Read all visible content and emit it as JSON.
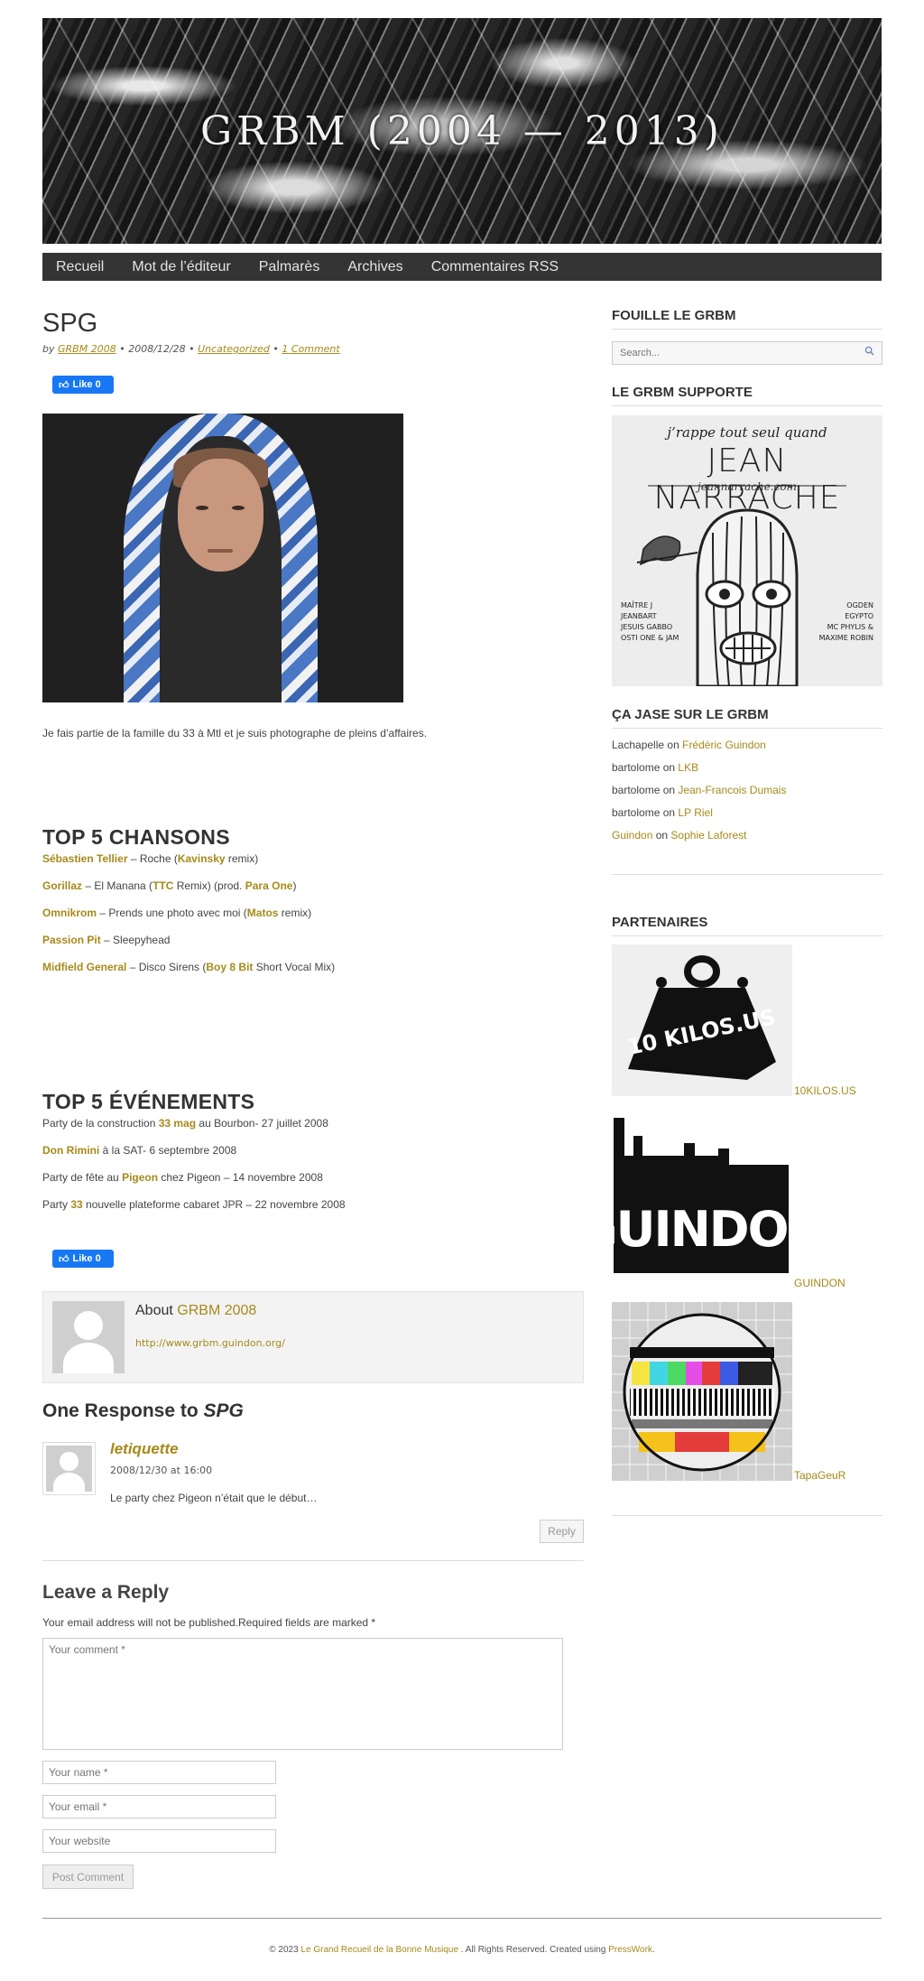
{
  "site": {
    "title": "GRBM (2004 — 2013)"
  },
  "nav": {
    "items": [
      "Recueil",
      "Mot de l’éditeur",
      "Palmarès",
      "Archives",
      "Commentaires RSS"
    ]
  },
  "post": {
    "title": "SPG",
    "meta": {
      "by": "by",
      "author": "GRBM 2008",
      "sep1": "•",
      "date": "2008/12/28",
      "sep2": "•",
      "category": "Uncategorized",
      "sep3": "•",
      "comments": "1 Comment"
    },
    "like_label": "Like 0",
    "intro": "Je fais partie de la famille du 33 à Mtl et je suis photographe de pleins d’affaires.",
    "chansons_title": "TOP 5 CHANSONS",
    "chansons": [
      {
        "artist": "Sébastien Tellier",
        "rest": [
          " – Roche (",
          "Kavinsky",
          " remix)"
        ]
      },
      {
        "artist": "Gorillaz",
        "rest": [
          " – El Manana (",
          "TTC",
          " Remix) (prod. ",
          "Para One",
          ")"
        ]
      },
      {
        "artist": "Omnikrom",
        "rest": [
          " – Prends une photo avec moi (",
          "Matos",
          " remix)"
        ]
      },
      {
        "artist": "Passion Pit",
        "rest": [
          " – Sleepyhead"
        ]
      },
      {
        "artist": "Midfield General",
        "rest": [
          " – Disco Sirens (",
          "Boy 8 Bit",
          " Short Vocal Mix)"
        ]
      }
    ],
    "evenements_title": "TOP 5 ÉVÉNEMENTS",
    "evenements": [
      [
        "Party de la construction ",
        "33 mag",
        " au Bourbon- 27 juillet 2008"
      ],
      [
        "",
        "Don Rimini",
        " à la SAT- 6 septembre 2008"
      ],
      [
        "Party de fête au ",
        "Pigeon",
        " chez Pigeon – 14 novembre 2008"
      ],
      [
        "Party ",
        "33",
        " nouvelle plateforme cabaret JPR – 22 novembre 2008"
      ]
    ]
  },
  "author_box": {
    "about": "About",
    "name": "GRBM 2008",
    "url": "http://www.grbm.guindon.org/"
  },
  "responses": {
    "title_prefix": "One Response to",
    "title_post": "SPG",
    "comment": {
      "author": "letiquette",
      "date": "2008/12/30 at 16:00",
      "text": "Le party chez Pigeon n’était que le début…",
      "reply_label": "Reply"
    }
  },
  "reply_form": {
    "title": "Leave a Reply",
    "note": "Your email address will not be published.Required fields are marked *",
    "comment_placeholder": "Your comment *",
    "name_placeholder": "Your name *",
    "email_placeholder": "Your email *",
    "website_placeholder": "Your website",
    "submit_label": "Post Comment"
  },
  "sidebar": {
    "search_title": "FOUILLE LE GRBM",
    "search_placeholder": "Search...",
    "supporte_title": "LE GRBM SUPPORTE",
    "narrache": {
      "script": "j’rappe tout seul quand",
      "name": "JEAN NARRACHE",
      "url": "jeannarrache.com",
      "left_names": [
        "MAÎTRE J",
        "JEANBART",
        "JESUIS GABBO",
        "OSTI ONE & JAM"
      ],
      "right_names": [
        "OGDEN",
        "EGYPTO",
        "MC PHYLIS &",
        "MAXIME ROBIN"
      ]
    },
    "jase_title": "ÇA JASE SUR LE GRBM",
    "recent_comments": [
      {
        "who": "Lachapelle",
        "on": "on",
        "post": "Frédéric Guindon"
      },
      {
        "who": "bartolome",
        "on": "on",
        "post": "LKB"
      },
      {
        "who": "bartolome",
        "on": "on",
        "post": "Jean-Francois Dumais"
      },
      {
        "who": "bartolome",
        "on": "on",
        "post": "LP Riel"
      },
      {
        "who": "Guindon",
        "on": "on",
        "post": "Sophie Laforest"
      }
    ],
    "partenaires_title": "PARTENAIRES",
    "partners": [
      "10KILOS.US",
      "GUINDON",
      "TapaGeuR"
    ],
    "kilos_logo": "10 KILOS.US",
    "guindon_logo": "GUINDON"
  },
  "footer": {
    "prefix": "© 2023 ",
    "site": "Le Grand Recueil de la Bonne Musique",
    "middle": " . All Rights Reserved. Created using ",
    "theme": "PressWork",
    "suffix": "."
  },
  "colors": {
    "link": "#a68a1a",
    "nav_bg": "#343434",
    "fb_blue": "#1877f2"
  }
}
